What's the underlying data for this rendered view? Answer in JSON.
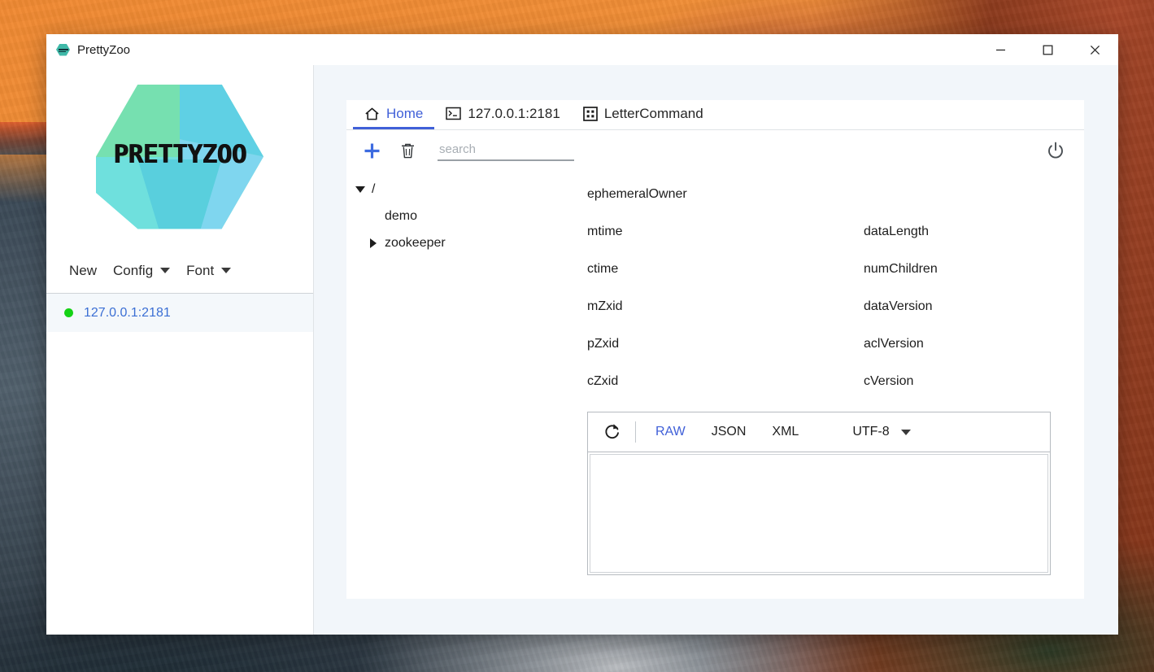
{
  "window": {
    "title": "PrettyZoo",
    "app_icon": "prettyzoo-hexagon-icon",
    "controls": {
      "minimize": "minimize-icon",
      "maximize": "maximize-icon",
      "close": "close-icon"
    }
  },
  "sidebar": {
    "logo_wordmark": "PRETTYZOO",
    "actions": [
      {
        "label": "New",
        "has_caret": false
      },
      {
        "label": "Config",
        "has_caret": true
      },
      {
        "label": "Font",
        "has_caret": true
      }
    ],
    "servers": [
      {
        "name": "127.0.0.1:2181",
        "status": "connected",
        "status_color": "#15d215",
        "selected": true
      }
    ]
  },
  "main": {
    "tabs": [
      {
        "label": "Home",
        "icon": "home-icon",
        "active": true
      },
      {
        "label": "127.0.0.1:2181",
        "icon": "terminal-icon",
        "active": false
      },
      {
        "label": "LetterCommand",
        "icon": "four-dots-icon",
        "active": false
      }
    ],
    "toolbar": {
      "add_icon": "plus-icon",
      "delete_icon": "trash-icon",
      "search_value": "",
      "search_placeholder": "search",
      "power_icon": "power-icon"
    },
    "tree": [
      {
        "label": "/",
        "state": "expanded",
        "depth": 0
      },
      {
        "label": "demo",
        "state": "leaf",
        "depth": 1
      },
      {
        "label": "zookeeper",
        "state": "collapsed",
        "depth": 1
      }
    ],
    "properties": [
      {
        "label": "ephemeralOwner",
        "value": ""
      },
      {
        "label": "",
        "value": ""
      },
      {
        "label": "mtime",
        "value": ""
      },
      {
        "label": "dataLength",
        "value": ""
      },
      {
        "label": "ctime",
        "value": ""
      },
      {
        "label": "numChildren",
        "value": ""
      },
      {
        "label": "mZxid",
        "value": ""
      },
      {
        "label": "dataVersion",
        "value": ""
      },
      {
        "label": "pZxid",
        "value": ""
      },
      {
        "label": "aclVersion",
        "value": ""
      },
      {
        "label": "cZxid",
        "value": ""
      },
      {
        "label": "cVersion",
        "value": ""
      }
    ],
    "viewer": {
      "refresh_icon": "refresh-icon",
      "formats": [
        {
          "label": "RAW",
          "active": true
        },
        {
          "label": "JSON",
          "active": false
        },
        {
          "label": "XML",
          "active": false
        }
      ],
      "encoding": "UTF-8",
      "encoding_caret": "chevron-down-icon",
      "content": ""
    }
  },
  "colors": {
    "accent": "#4060d8",
    "link": "#3b6fd4",
    "status_ok": "#15d215",
    "logo_green": "#76e0b0",
    "logo_cyan": "#5fd0e4",
    "logo_blue": "#7fd6ef",
    "panel_bg": "#f2f6fa"
  }
}
